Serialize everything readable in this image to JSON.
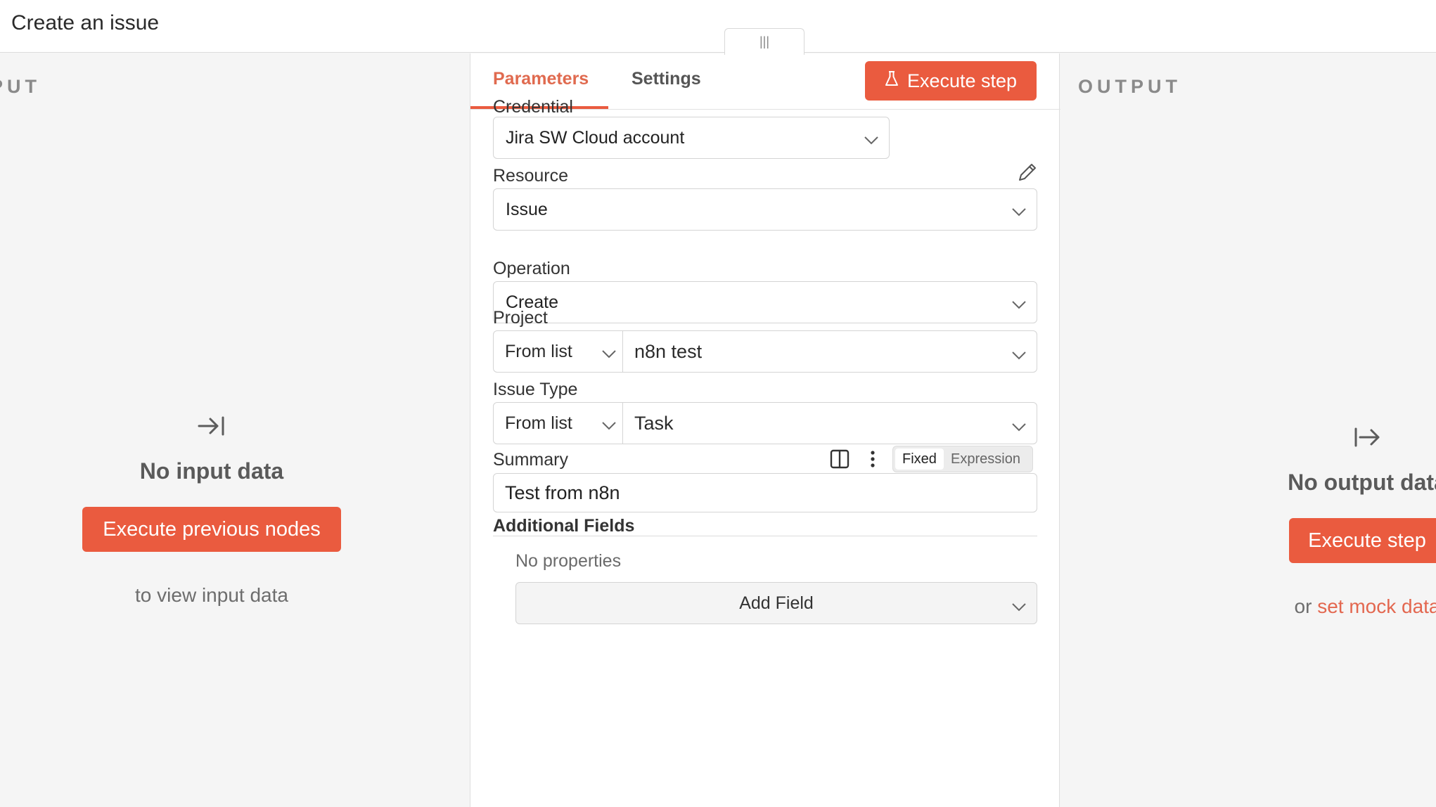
{
  "header": {
    "title": "Create an issue",
    "drag_handle": "|||"
  },
  "input_panel": {
    "heading": "PUT",
    "icon": "arrow-right-to-bar-icon",
    "empty_title": "No input data",
    "button": "Execute previous nodes",
    "hint": "to view input data"
  },
  "output_panel": {
    "heading": "OUTPUT",
    "icon": "arrow-from-bar-right-icon",
    "empty_title": "No output data",
    "button": "Execute step",
    "hint_prefix": "or",
    "hint_link": "set mock data"
  },
  "tabs": {
    "parameters": "Parameters",
    "settings": "Settings",
    "active": "Parameters"
  },
  "execute_button": {
    "label": "Execute step",
    "icon": "flask-icon"
  },
  "form": {
    "credential": {
      "label": "Credential",
      "value": "Jira SW Cloud account"
    },
    "resource": {
      "label": "Resource",
      "value": "Issue"
    },
    "operation": {
      "label": "Operation",
      "value": "Create"
    },
    "project": {
      "label": "Project",
      "mode": "From list",
      "value": "n8n test"
    },
    "issue_type": {
      "label": "Issue Type",
      "mode": "From list",
      "value": "Task"
    },
    "summary": {
      "label": "Summary",
      "value": "Test from n8n",
      "toggle_fixed": "Fixed",
      "toggle_expression": "Expression",
      "selected": "Fixed"
    },
    "additional_fields": {
      "title": "Additional Fields",
      "empty": "No properties",
      "add_button": "Add Field"
    }
  },
  "colors": {
    "accent": "#ea5b3f",
    "link": "#e3674f",
    "background": "#f5f5f5"
  }
}
